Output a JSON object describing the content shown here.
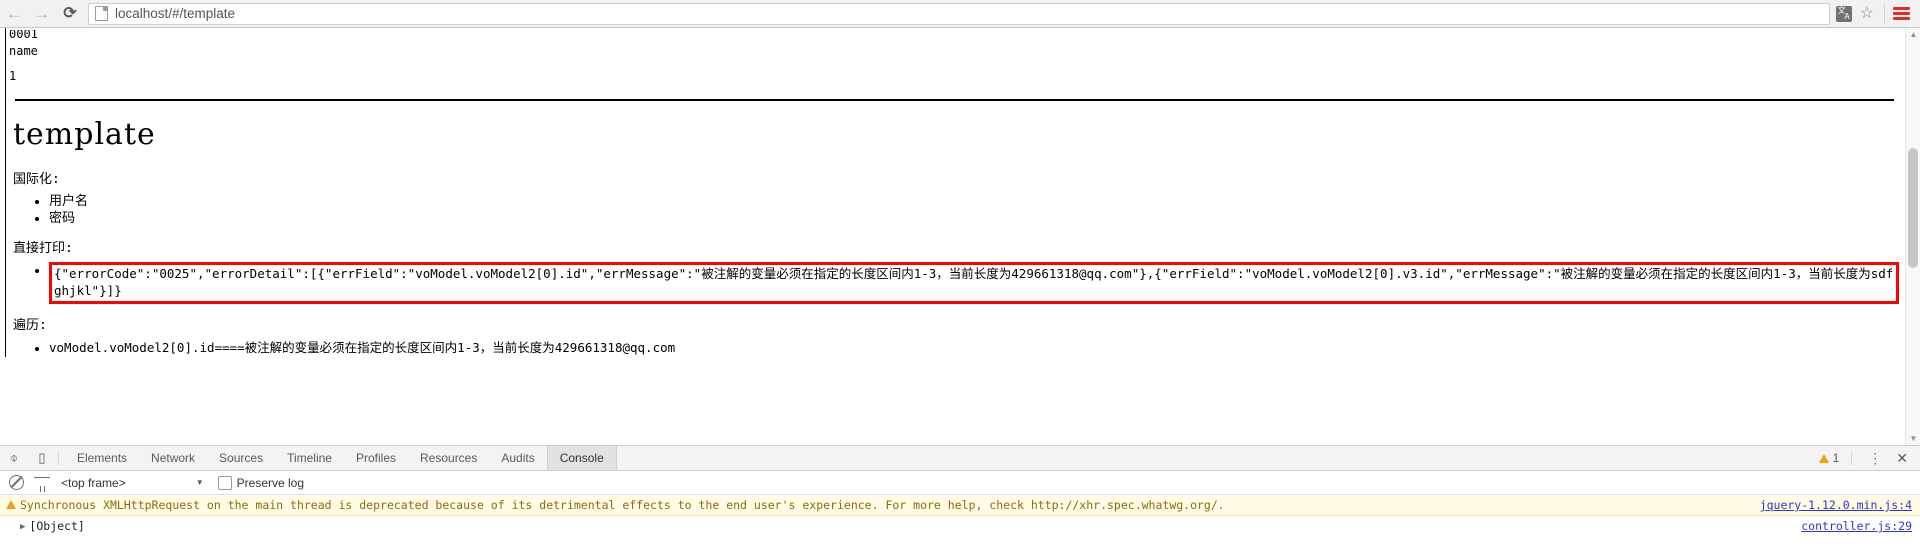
{
  "browser": {
    "back_label": "←",
    "forward_label": "→",
    "reload_label": "⟳",
    "url": "localhost/#/template",
    "page_icon": "page-document-icon",
    "translate_icon_top": "文",
    "translate_icon_bottom": "A",
    "star_label": "☆",
    "menu_label": "menu-icon"
  },
  "page": {
    "fragment_lines": [
      "0001",
      "name",
      "1"
    ],
    "heading": "template",
    "i18n_label": "国际化:",
    "i18n_items": [
      "用户名",
      "密码"
    ],
    "print_label": "直接打印:",
    "json_output": "{\"errorCode\":\"0025\",\"errorDetail\":[{\"errField\":\"voModel.voModel2[0].id\",\"errMessage\":\"被注解的变量必须在指定的长度区间内1-3，当前长度为429661318@qq.com\"},{\"errField\":\"voModel.voModel2[0].v3.id\",\"errMessage\":\"被注解的变量必须在指定的长度区间内1-3，当前长度为sdfghjkl\"}]}",
    "traverse_label": "遍历:",
    "traverse_items": [
      "voModel.voModel2[0].id====被注解的变量必须在指定的长度区间内1-3，当前长度为429661318@qq.com"
    ],
    "annotation_color": "#ff0000"
  },
  "devtools": {
    "inspect_icon": "inspect-element-icon",
    "device_icon": "device-toolbar-icon",
    "tabs": [
      {
        "label": "Elements",
        "active": false
      },
      {
        "label": "Network",
        "active": false
      },
      {
        "label": "Sources",
        "active": false
      },
      {
        "label": "Timeline",
        "active": false
      },
      {
        "label": "Profiles",
        "active": false
      },
      {
        "label": "Resources",
        "active": false
      },
      {
        "label": "Audits",
        "active": false
      },
      {
        "label": "Console",
        "active": true
      }
    ],
    "warning_count": "1",
    "kebab_label": "⋮",
    "close_label": "✕",
    "console_toolbar": {
      "clear_icon": "clear-console-icon",
      "filter_icon": "filter-icon",
      "frame_value": "<top frame>",
      "frame_caret": "▼",
      "preserve_log_label": "Preserve log",
      "preserve_log_checked": false
    },
    "console_rows": [
      {
        "level": "warning",
        "expander": "",
        "message": "Synchronous XMLHttpRequest on the main thread is deprecated because of its detrimental effects to the end user's experience. For more help, check http://xhr.spec.whatwg.org/.",
        "source": "jquery-1.12.0.min.js:4"
      },
      {
        "level": "normal",
        "expander": "▶",
        "message": "[Object]",
        "source": "controller.js:29"
      }
    ]
  }
}
